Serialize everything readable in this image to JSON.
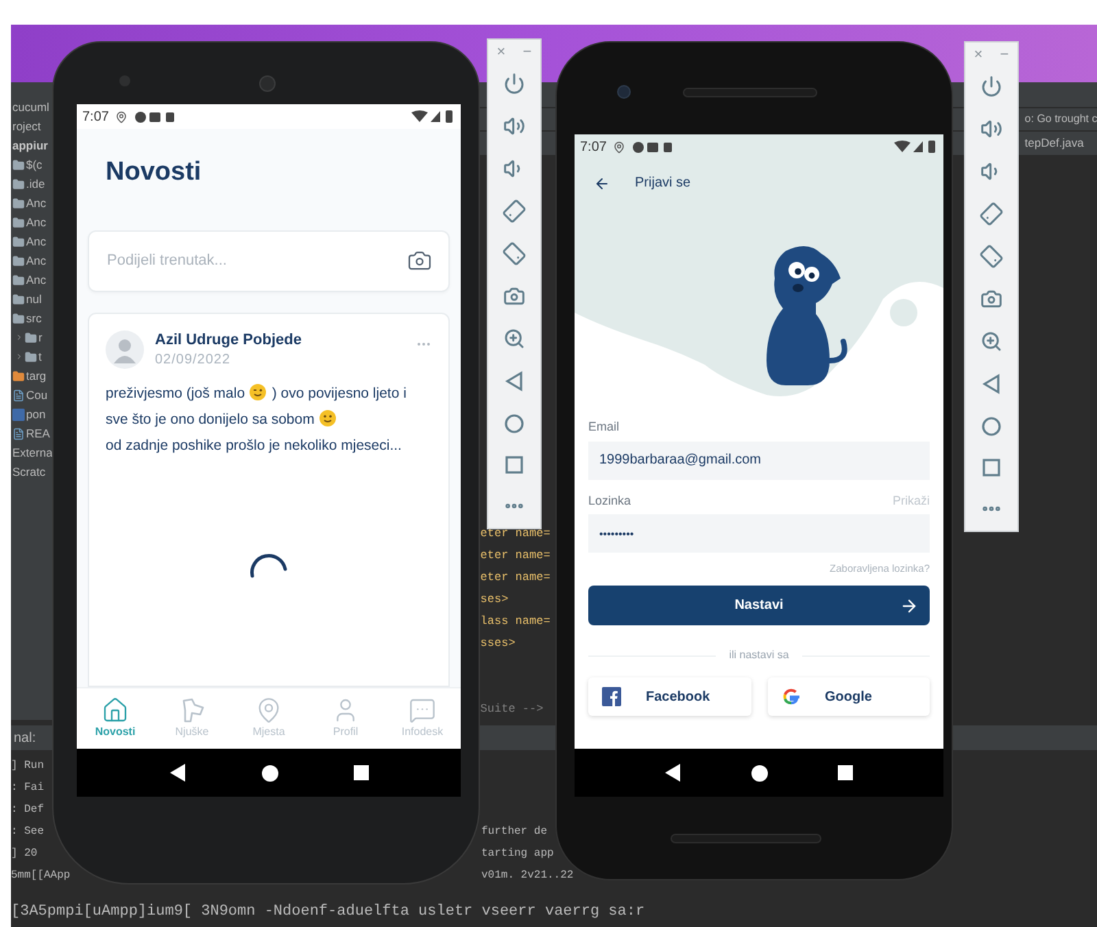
{
  "ide": {
    "project_tree": [
      {
        "label": "cucuml",
        "kind": "title"
      },
      {
        "label": "roject",
        "kind": "plain"
      },
      {
        "label": "appiur",
        "kind": "module"
      },
      {
        "label": "$(c",
        "kind": "folder"
      },
      {
        "label": ".ide",
        "kind": "folder"
      },
      {
        "label": "Anc",
        "kind": "folder"
      },
      {
        "label": "Anc",
        "kind": "folder"
      },
      {
        "label": "Anc",
        "kind": "folder"
      },
      {
        "label": "Anc",
        "kind": "folder"
      },
      {
        "label": "Anc",
        "kind": "folder"
      },
      {
        "label": "nul",
        "kind": "folder"
      },
      {
        "label": "src",
        "kind": "folder",
        "children": [
          {
            "label": "r",
            "kind": "folder",
            "expanded": false
          },
          {
            "label": "t",
            "kind": "folder",
            "expanded": false
          }
        ]
      },
      {
        "label": "targ",
        "kind": "excluded_folder"
      },
      {
        "label": "Cou",
        "kind": "file"
      },
      {
        "label": "pon",
        "kind": "maven"
      },
      {
        "label": "REA",
        "kind": "file"
      },
      {
        "label": "Externa",
        "kind": "plain"
      },
      {
        "label": "Scratc",
        "kind": "plain"
      }
    ],
    "editor": {
      "breadcrumb": "o: Go trought c",
      "file_tab": "tepDef.java",
      "code_lines": [
        {
          "text": "eter name=",
          "kind": "tag"
        },
        {
          "text": "eter name=",
          "kind": "tag"
        },
        {
          "text": "eter name=",
          "kind": "tag"
        },
        {
          "text": "ses>",
          "kind": "tag"
        },
        {
          "text": "lass name=",
          "kind": "tag"
        },
        {
          "text": "sses>",
          "kind": "tag"
        },
        {
          "kind": "blank"
        },
        {
          "kind": "blank"
        },
        {
          "text": "Suite -->",
          "kind": "comment"
        }
      ]
    },
    "console": {
      "title": "nal:",
      "rows": [
        {
          "left": "] Run"
        },
        {
          "left": ": Fai"
        },
        {
          "left": ": Def"
        },
        {
          "left": ": See",
          "right": "further de"
        },
        {
          "left": "] 20",
          "right": "tarting app"
        },
        {
          "left": "5mm[[AApp",
          "right": "v01m. 2v21..22"
        },
        {
          "left": "[3A5pmpi[uAmpp]ium9[ 3N9omn -Ndoenf-aduelfta usletr vseerr vaerrg sa:r"
        }
      ]
    }
  },
  "emulator_toolbars": [
    {
      "close": "×",
      "minimize": "−"
    },
    {
      "close": "×",
      "minimize": "−"
    }
  ],
  "feed_phone": {
    "status_time": "7:07",
    "title": "Novosti",
    "composer": {
      "placeholder": "Podijeli trenutak..."
    },
    "post": {
      "author": "Azil Udruge Pobjede",
      "date": "02/09/2022",
      "loading": true,
      "lines": [
        [
          {
            "kind": "text",
            "text": "preživjesmo (još malo "
          },
          {
            "kind": "wink_emoji"
          },
          {
            "kind": "text",
            "text": " ) ovo povijesno ljeto i"
          }
        ],
        [
          {
            "kind": "text",
            "text": "sve što je ono donijelo sa sobom "
          },
          {
            "kind": "smile_emoji"
          }
        ],
        [
          {
            "kind": "text",
            "text": "od zadnje poshike prošlo je nekoliko mjeseci..."
          }
        ]
      ]
    },
    "bottom_nav": [
      {
        "label": "Novosti",
        "kind": "home",
        "selected": true
      },
      {
        "label": "Njuške",
        "kind": "dog",
        "selected": false
      },
      {
        "label": "Mjesta",
        "kind": "pin",
        "selected": false
      },
      {
        "label": "Profil",
        "kind": "user",
        "selected": false
      },
      {
        "label": "Infodesk",
        "kind": "chat",
        "selected": false
      }
    ]
  },
  "login_phone": {
    "status_time": "7:07",
    "header_title": "Prijavi se",
    "email": {
      "label": "Email",
      "value": "1999barbaraa@gmail.com"
    },
    "password": {
      "label": "Lozinka",
      "show_label": "Prikaži",
      "value": "•••••••••"
    },
    "forgot_link": "Zaboravljena lozinka?",
    "submit": "Nastavi",
    "divider": "ili nastavi sa",
    "social": [
      {
        "label": "Facebook",
        "kind": "facebook"
      },
      {
        "label": "Google",
        "kind": "google"
      }
    ]
  }
}
